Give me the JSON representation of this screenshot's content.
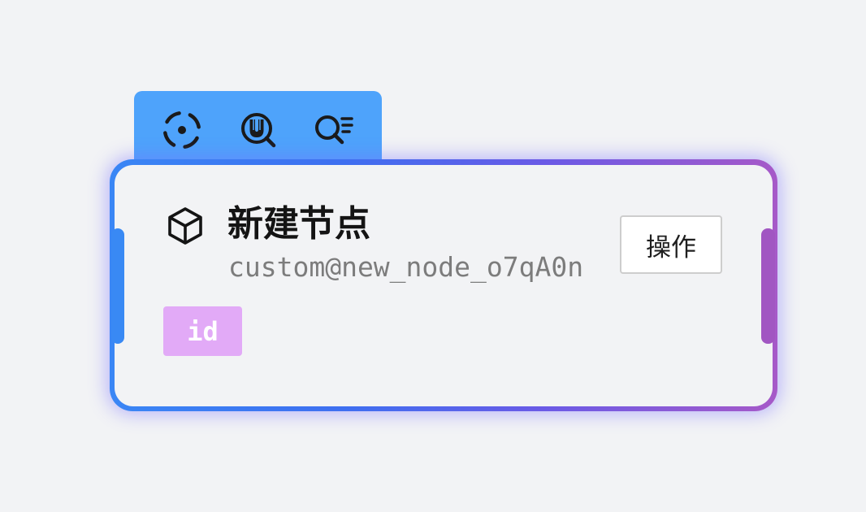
{
  "toolbar": {
    "buttons": [
      {
        "name": "focus-icon",
        "color": "#1a1a1a"
      },
      {
        "name": "search-user-icon",
        "color": "#1a1a1a"
      },
      {
        "name": "search-list-icon",
        "color": "#1a1a1a"
      }
    ],
    "background": "#4ea3fb"
  },
  "node": {
    "icon": "cube-icon",
    "title": "新建节点",
    "id_text": "custom@new_node_o7qA0n",
    "action_label": "操作",
    "tags": [
      {
        "label": "id",
        "color": "#e2aaf7"
      }
    ],
    "border_gradient": [
      "#3a86f5",
      "#6a5ae6",
      "#a659c8"
    ],
    "left_handle_color": "#3989f4",
    "right_handle_color": "#a156c2"
  }
}
